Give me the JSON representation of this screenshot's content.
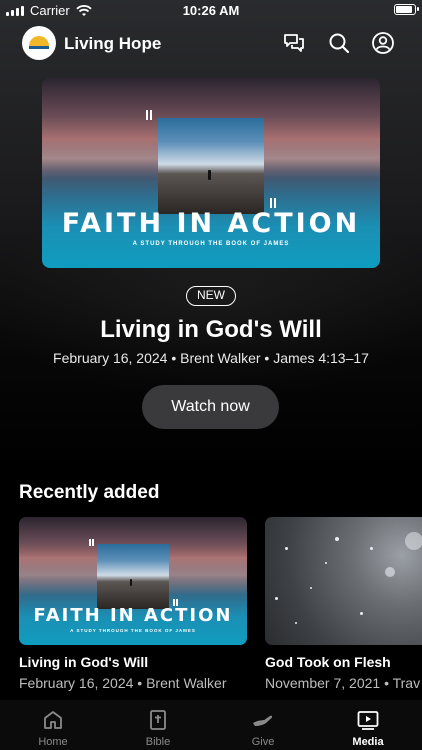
{
  "status_bar": {
    "carrier": "Carrier",
    "time": "10:26 AM"
  },
  "header": {
    "app_name": "Living Hope",
    "icons": [
      "chat-bubbles-icon",
      "search-icon",
      "account-icon"
    ]
  },
  "hero": {
    "art_title": "FAITH IN ACTION",
    "art_subtitle": "A STUDY THROUGH THE BOOK OF JAMES",
    "badge": "NEW",
    "title": "Living in God's Will",
    "meta": "February 16, 2024 • Brent Walker • James 4:13–17",
    "watch_button": "Watch now"
  },
  "recently_added": {
    "heading": "Recently added",
    "items": [
      {
        "title": "Living in God's Will",
        "meta": "February 16, 2024 • Brent Walker",
        "art_title": "FAITH IN ACTION",
        "art_subtitle": "A STUDY THROUGH THE BOOK OF JAMES"
      },
      {
        "title": "God Took on Flesh",
        "meta": "November 7, 2021 • Trav"
      }
    ]
  },
  "tabbar": {
    "tabs": [
      {
        "label": "Home",
        "icon": "home-icon",
        "active": false
      },
      {
        "label": "Bible",
        "icon": "bible-icon",
        "active": false
      },
      {
        "label": "Give",
        "icon": "give-hand-icon",
        "active": false
      },
      {
        "label": "Media",
        "icon": "media-play-icon",
        "active": true
      }
    ]
  },
  "colors": {
    "background": "#000000",
    "button": "#3a3a3c",
    "inactive_tab": "#8a8a8a"
  }
}
